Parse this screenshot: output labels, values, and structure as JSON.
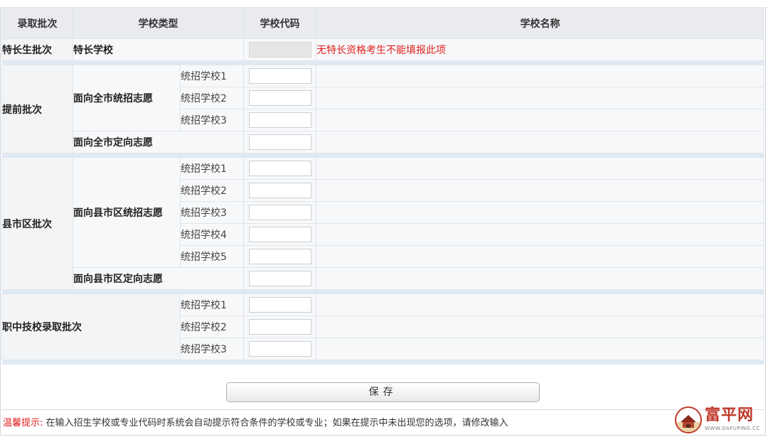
{
  "headers": {
    "batch": "录取批次",
    "type": "学校类型",
    "code": "学校代码",
    "name": "学校名称"
  },
  "special": {
    "batch": "特长生批次",
    "type": "特长学校",
    "warning": "无特长资格考生不能填报此项"
  },
  "advance": {
    "batch": "提前批次",
    "unified": "面向全市统招志愿",
    "directed": "面向全市定向志愿",
    "schools": [
      "统招学校1",
      "统招学校2",
      "统招学校3"
    ]
  },
  "county": {
    "batch": "县市区批次",
    "unified": "面向县市区统招志愿",
    "directed": "面向县市区定向志愿",
    "schools": [
      "统招学校1",
      "统招学校2",
      "统招学校3",
      "统招学校4",
      "统招学校5"
    ]
  },
  "vocational": {
    "batch": "职中技校录取批次",
    "schools": [
      "统招学校1",
      "统招学校2",
      "统招学校3"
    ]
  },
  "save_label": "保存",
  "tip": {
    "label": "温馨提示:",
    "text": "在输入招生学校或专业代码时系统会自动提示符合条件的学校或专业；如果在提示中未出现您的选项，请修改输入"
  },
  "watermark": {
    "brand": "富平网",
    "url": "WWW.DAFUPING.CC"
  },
  "colors": {
    "warning": "#e02020",
    "header_bg": "#e9ebee",
    "separator": "#dfe9f3",
    "brand": "#c0392b"
  }
}
